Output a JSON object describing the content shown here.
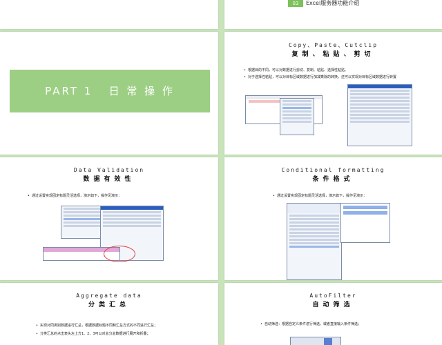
{
  "slide1": {
    "badge": "03",
    "title": "Excel服务器功能介绍"
  },
  "slide2": {
    "title": "PART 1   日 常 操 作"
  },
  "slide3": {
    "title": "Copy、Paste、Cutclip",
    "subtitle": "复制、粘贴、剪切",
    "bullets": [
      "根据目的不同，可以对数据进行剪切、复制、粘贴、选择性粘贴。",
      "对于选择性粘贴，可以对目标区域数据进行加减乘除的转换，还可以实现对目标区域数据进行转置"
    ]
  },
  "slide4": {
    "title": "Data Validation",
    "subtitle": "数据有效性",
    "bullets": [
      "通过设置实现固定标题灵活选择，演示如下，操作见演示："
    ]
  },
  "slide5": {
    "title": "Conditional formatting",
    "subtitle": "条件格式",
    "bullets": [
      "通过设置实现固定标题灵活选择，演示如下，操作见演示："
    ]
  },
  "slide6": {
    "title": "Aggregate data",
    "subtitle": "分类汇总",
    "bullets": [
      "实现对同类别数据进行汇总，根据数据标题不同和汇总方式的不同进行汇总；",
      "分类汇总的点击表头左上方1、2、3可以对总分总数据进行展开和折叠；"
    ]
  },
  "slide7": {
    "title": "AutoFilter",
    "subtitle": "自动筛选",
    "bullets": [
      "自动筛选：根据自定义条件进行筛选，或者直接输入条件筛选；"
    ]
  },
  "colors": {
    "background": "#c9e4bb",
    "accent": "#9ccf84",
    "part_bg": "#9ccf84"
  }
}
